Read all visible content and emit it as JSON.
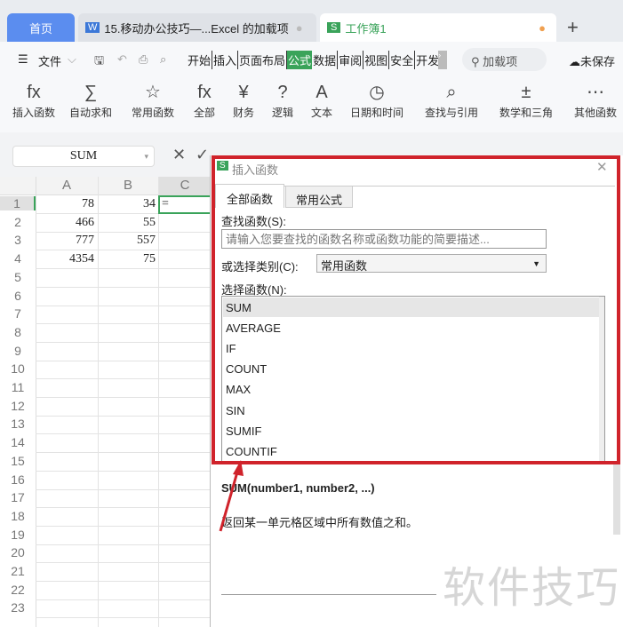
{
  "tabs": {
    "home": "首页",
    "doc": "15.移动办公技巧—...Excel 的加载项",
    "book": "工作簿1",
    "add": "+"
  },
  "menu": {
    "file": "文件",
    "items": [
      "开始",
      "插入",
      "页面布局",
      "公式",
      "数据",
      "审阅",
      "视图",
      "安全",
      "开发"
    ],
    "active": "公式",
    "search": "加载项",
    "unsaved": "未保存"
  },
  "ribbon": [
    {
      "icon": "fx",
      "label": "插入函数"
    },
    {
      "icon": "∑",
      "label": "自动求和"
    },
    {
      "icon": "☆",
      "label": "常用函数"
    },
    {
      "icon": "fx",
      "label": "全部"
    },
    {
      "icon": "¥",
      "label": "财务"
    },
    {
      "icon": "?",
      "label": "逻辑"
    },
    {
      "icon": "A",
      "label": "文本"
    },
    {
      "icon": "◷",
      "label": "日期和时间"
    },
    {
      "icon": "⌕",
      "label": "查找与引用"
    },
    {
      "icon": "±",
      "label": "数学和三角"
    },
    {
      "icon": "⋯",
      "label": "其他函数"
    }
  ],
  "namebox": "SUM",
  "columns": [
    "A",
    "B",
    "C"
  ],
  "rows": [
    "1",
    "2",
    "3",
    "4",
    "5",
    "6",
    "7",
    "8",
    "9",
    "10",
    "11",
    "12",
    "13",
    "14",
    "15",
    "16",
    "17",
    "18",
    "19",
    "20",
    "21",
    "22",
    "23"
  ],
  "cells": [
    [
      "78",
      "34",
      "="
    ],
    [
      "466",
      "55",
      ""
    ],
    [
      "777",
      "557",
      ""
    ],
    [
      "4354",
      "75",
      ""
    ]
  ],
  "dialog": {
    "title": "插入函数",
    "tabs": [
      "全部函数",
      "常用公式"
    ],
    "search_label": "查找函数(S):",
    "search_placeholder": "请输入您要查找的函数名称或函数功能的简要描述...",
    "category_label": "或选择类别(C):",
    "category_value": "常用函数",
    "list_label": "选择函数(N):",
    "functions": [
      "SUM",
      "AVERAGE",
      "IF",
      "COUNT",
      "MAX",
      "SIN",
      "SUMIF",
      "COUNTIF"
    ],
    "signature": "SUM(number1, number2, ...)",
    "description": "返回某一单元格区域中所有数值之和。"
  },
  "watermark": "软件技巧",
  "colors": {
    "accent": "#3aa35a",
    "highlight": "#d0232b",
    "home_tab": "#5b8def"
  }
}
